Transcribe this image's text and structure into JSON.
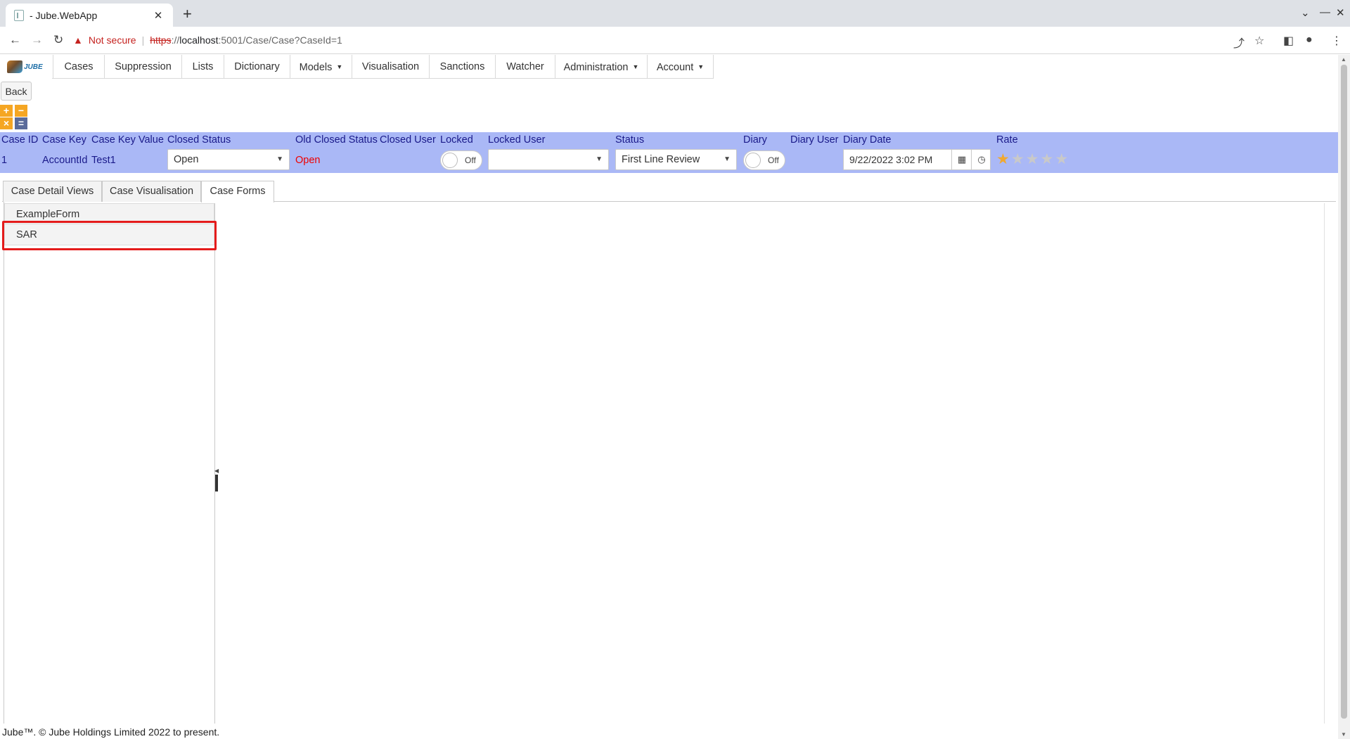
{
  "browser": {
    "tab_title": "- Jube.WebApp",
    "new_tab_icon": "+",
    "address": {
      "security_label": "Not secure",
      "scheme": "https",
      "host_separator": "://",
      "host": "localhost",
      "path": ":5001/Case/Case?CaseId=1"
    }
  },
  "logo_text": "JUBE",
  "menu": {
    "items": [
      {
        "label": "Cases",
        "dropdown": false
      },
      {
        "label": "Suppression",
        "dropdown": false
      },
      {
        "label": "Lists",
        "dropdown": false
      },
      {
        "label": "Dictionary",
        "dropdown": false
      },
      {
        "label": "Models",
        "dropdown": true
      },
      {
        "label": "Visualisation",
        "dropdown": false
      },
      {
        "label": "Sanctions",
        "dropdown": false
      },
      {
        "label": "Watcher",
        "dropdown": false
      },
      {
        "label": "Administration",
        "dropdown": true
      },
      {
        "label": "Account",
        "dropdown": true
      }
    ]
  },
  "back_label": "Back",
  "tiles": {
    "plus": "+",
    "minus": "−",
    "times": "×",
    "equals": "="
  },
  "colors": {
    "case_bar": "#aab8f6",
    "header_text": "#1a1a8a",
    "old_status": "#e00000",
    "highlight_box": "#e41b1b",
    "star_active": "#f0a830",
    "tile_orange": "#f5a623",
    "tile_slate": "#5a6b9a"
  },
  "case": {
    "headers": {
      "case_id": "Case ID",
      "case_key": "Case Key",
      "case_key_value": "Case Key Value",
      "closed_status": "Closed Status",
      "old_closed_status": "Old Closed Status",
      "closed_user": "Closed User",
      "locked": "Locked",
      "locked_user": "Locked User",
      "status": "Status",
      "diary": "Diary",
      "diary_user": "Diary User",
      "diary_date": "Diary Date",
      "rate": "Rate"
    },
    "values": {
      "case_id": "1",
      "case_key": "AccountId",
      "case_key_value": "Test1",
      "closed_status": "Open",
      "old_closed_status": "Open",
      "locked": "Off",
      "locked_user": "",
      "status": "First Line Review",
      "diary": "Off",
      "diary_date": "9/22/2022 3:02 PM",
      "rate": 1,
      "rate_max": 5
    }
  },
  "tabs": [
    {
      "label": "Case Detail Views",
      "active": false
    },
    {
      "label": "Case Visualisation",
      "active": false
    },
    {
      "label": "Case Forms",
      "active": true
    }
  ],
  "forms": [
    {
      "label": "ExampleForm",
      "selected": false
    },
    {
      "label": "SAR",
      "selected": true
    }
  ],
  "footer": "Jube™. © Jube Holdings Limited 2022 to present."
}
